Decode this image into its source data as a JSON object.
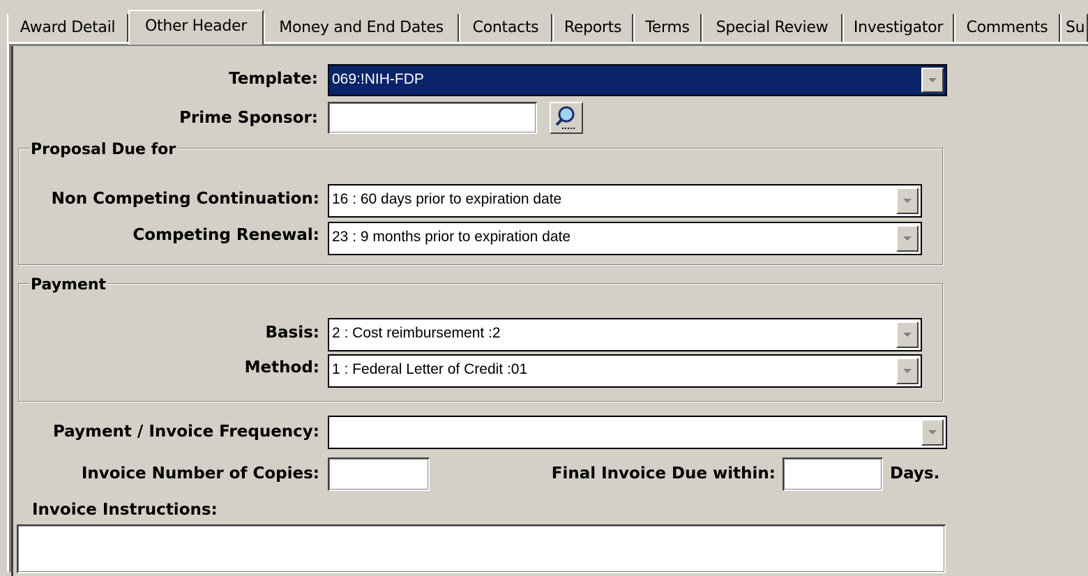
{
  "tabs": [
    {
      "label": "Award Detail",
      "active": false
    },
    {
      "label": "Other Header",
      "active": true
    },
    {
      "label": "Money and End Dates",
      "active": false
    },
    {
      "label": "Contacts",
      "active": false
    },
    {
      "label": "Reports",
      "active": false
    },
    {
      "label": "Terms",
      "active": false
    },
    {
      "label": "Special Review",
      "active": false
    },
    {
      "label": "Investigator",
      "active": false
    },
    {
      "label": "Comments",
      "active": false
    },
    {
      "label": "Su",
      "active": false
    }
  ],
  "form": {
    "template_label": "Template:",
    "template_value": "069:!NIH-FDP",
    "prime_sponsor_label": "Prime Sponsor:",
    "prime_sponsor_value": "",
    "lookup_icon": "magnifier-icon",
    "proposal_group_title": "Proposal Due for",
    "non_competing_label": "Non Competing Continuation:",
    "non_competing_value": "16 : 60 days prior to expiration date",
    "competing_label": "Competing Renewal:",
    "competing_value": "23 : 9 months prior to expiration date",
    "payment_group_title": "Payment",
    "basis_label": "Basis:",
    "basis_value": "2 : Cost reimbursement :2",
    "method_label": "Method:",
    "method_value": "1 : Federal Letter of Credit :01",
    "frequency_label": "Payment / Invoice Frequency:",
    "frequency_value": "",
    "copies_label": "Invoice Number of Copies:",
    "copies_value": "",
    "final_invoice_label": "Final Invoice Due within:",
    "final_invoice_value": "",
    "days_label": "Days.",
    "instructions_label": "Invoice Instructions:",
    "instructions_value": ""
  },
  "colors": {
    "window_bg": "#d4d0c8",
    "selection_bg": "#0a246a",
    "selection_fg": "#ffffff"
  }
}
